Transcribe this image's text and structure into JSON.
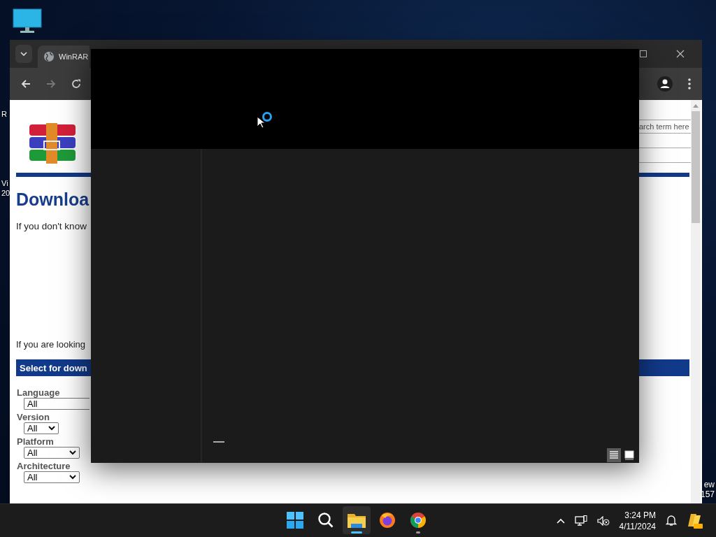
{
  "desktop_labels_left": [
    {
      "lines": [
        "R"
      ]
    },
    {
      "lines": [
        "Vi",
        "20"
      ]
    }
  ],
  "desktop_labels_right": [
    {
      "lines": [
        "ew",
        "157"
      ]
    }
  ],
  "browser": {
    "tab_title": "WinRAR",
    "page": {
      "heading": "Downloa",
      "intro": "If you don't know",
      "note": "If you are looking",
      "banner": "Select for down",
      "search": {
        "placeholder": "arch term here"
      },
      "filters": [
        {
          "label": "Language",
          "value": "All",
          "arrow": false
        },
        {
          "label": "Version",
          "value": "All",
          "arrow": true
        },
        {
          "label": "Platform",
          "value": "All",
          "arrow": true
        },
        {
          "label": "Architecture",
          "value": "All",
          "arrow": true
        }
      ]
    }
  },
  "explorer": {
    "loading": true,
    "view_buttons": [
      {
        "kind": "details",
        "selected": true
      },
      {
        "kind": "tiles",
        "selected": false
      }
    ]
  },
  "taskbar": {
    "apps": [
      {
        "kind": "start",
        "selected": false,
        "running": false
      },
      {
        "kind": "search",
        "selected": false,
        "running": false
      },
      {
        "kind": "files",
        "selected": true,
        "running": true
      },
      {
        "kind": "firefox",
        "selected": false,
        "running": false
      },
      {
        "kind": "chrome",
        "selected": false,
        "running": true
      }
    ],
    "clock": {
      "time": "3:24 PM",
      "date": "4/11/2024"
    }
  }
}
